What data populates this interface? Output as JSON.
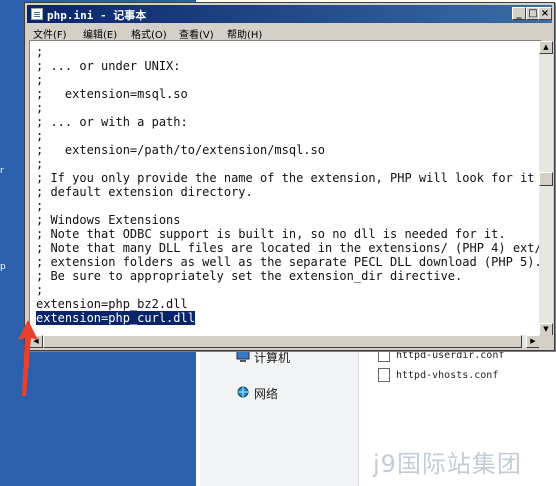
{
  "desktop": {
    "edge_marks": [
      "r",
      "p"
    ]
  },
  "explorer": {
    "nav_items": [
      "计算机",
      "网络"
    ],
    "files": [
      "httpd-userdir.conf",
      "httpd-vhosts.conf"
    ]
  },
  "watermark": "j9国际站集团",
  "notepad": {
    "title": "php.ini - 记事本",
    "controls": {
      "minimize": "_",
      "maximize": "□",
      "close": "×"
    },
    "menu": [
      "文件(F)",
      "编辑(E)",
      "格式(O)",
      "查看(V)",
      "帮助(H)"
    ],
    "lines": [
      ";",
      "; ... or under UNIX:",
      ";",
      ";   extension=msql.so",
      ";",
      "; ... or with a path:",
      ";",
      ";   extension=/path/to/extension/msql.so",
      ";",
      "; If you only provide the name of the extension, PHP will look for it in",
      "; default extension directory.",
      ";",
      "; Windows Extensions",
      "; Note that ODBC support is built in, so no dll is needed for it.",
      "; Note that many DLL files are located in the extensions/ (PHP 4) ext/",
      "; extension folders as well as the separate PECL DLL download (PHP 5).",
      "; Be sure to appropriately set the extension_dir directive.",
      ";",
      "extension=php_bz2.dll",
      "extension=php_curl.dll"
    ],
    "selected_line": "extension=php_curl.dll",
    "scrollbar": {
      "up": "▲",
      "down": "▼",
      "left": "◀",
      "right": "▶"
    }
  },
  "annotation": {
    "arrow_color": "#e8402f"
  }
}
